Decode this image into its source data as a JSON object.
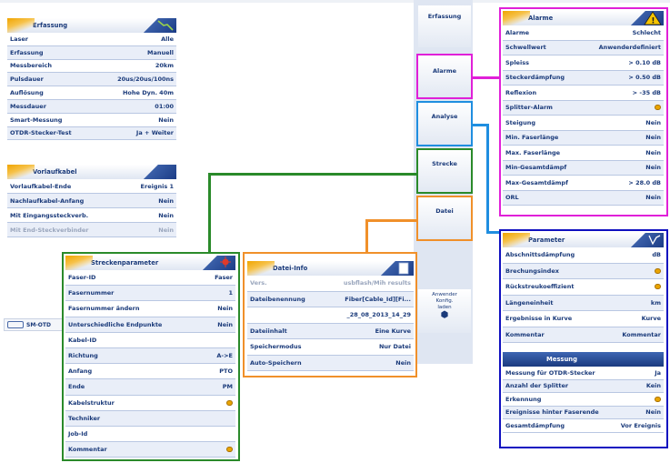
{
  "erfassung_panel": {
    "title": "Erfassung",
    "rows": [
      {
        "label": "Laser",
        "value": "Alle"
      },
      {
        "label": "Erfassung",
        "value": "Manuell"
      },
      {
        "label": "Messbereich",
        "value": "20km"
      },
      {
        "label": "Pulsdauer",
        "value": "20us/20us/100ns"
      },
      {
        "label": "Auflösung",
        "value": "Hohe Dyn. 40m"
      },
      {
        "label": "Messdauer",
        "value": "01:00"
      },
      {
        "label": "Smart-Messung",
        "value": "Nein"
      },
      {
        "label": "OTDR-Stecker-Test",
        "value": "Ja + Weiter"
      }
    ]
  },
  "vorlaufkabel_panel": {
    "title": "Vorlaufkabel",
    "rows": [
      {
        "label": "Vorlaufkabel-Ende",
        "value": "Ereignis 1"
      },
      {
        "label": "Nachlaufkabel-Anfang",
        "value": "Nein"
      },
      {
        "label": "Mit Eingangssteckverb.",
        "value": "Nein"
      },
      {
        "label": "Mit End-Steckverbinder",
        "value": "Nein"
      }
    ]
  },
  "status_bar": {
    "label": "SM-OTD"
  },
  "right_menu": {
    "erfassung": "Erfassung",
    "alarme": "Alarme",
    "analyse": "Analyse",
    "strecke": "Strecke",
    "datei": "Datei",
    "bottom": [
      "Anwender",
      "Konfig.",
      "laden"
    ]
  },
  "alarme_panel": {
    "title": "Alarme",
    "rows": [
      {
        "label": "Alarme",
        "value": "Schlecht"
      },
      {
        "label": "Schwellwert",
        "value": "Anwenderdefiniert"
      },
      {
        "label": "Spleiss",
        "value": "> 0.10 dB"
      },
      {
        "label": "Steckerdämpfung",
        "value": "> 0.50 dB"
      },
      {
        "label": "Reflexion",
        "value": "> -35 dB"
      },
      {
        "label": "Splitter-Alarm",
        "value": ""
      },
      {
        "label": "Steigung",
        "value": "Nein"
      },
      {
        "label": "Min. Faserlänge",
        "value": "Nein"
      },
      {
        "label": "Max. Faserlänge",
        "value": "Nein"
      },
      {
        "label": "Min-Gesamtdämpf",
        "value": "Nein"
      },
      {
        "label": "Max-Gesamtdämpf",
        "value": "> 28.0 dB"
      },
      {
        "label": "ORL",
        "value": "Nein"
      }
    ]
  },
  "parameter_panel": {
    "title": "Parameter",
    "rows": [
      {
        "label": "Abschnittsdämpfung",
        "value": "dB"
      },
      {
        "label": "Brechungsindex",
        "value": ""
      },
      {
        "label": "Rückstreukoeffizient",
        "value": ""
      },
      {
        "label": "Längeneinheit",
        "value": "km"
      },
      {
        "label": "Ergebnisse in Kurve",
        "value": "Kurve"
      },
      {
        "label": "Kommentar",
        "value": "Kommentar"
      }
    ]
  },
  "messung_panel": {
    "title": "Messung",
    "rows": [
      {
        "label": "Messung für OTDR-Stecker",
        "value": "Ja"
      },
      {
        "label": "Anzahl der Splitter",
        "value": "Kein"
      },
      {
        "label": "Erkennung",
        "value": ""
      },
      {
        "label": "Ereignisse hinter Faserende",
        "value": "Nein"
      },
      {
        "label": "Gesamtdämpfung",
        "value": "Vor Ereignis"
      }
    ]
  },
  "streckenparameter_panel": {
    "title": "Streckenparameter",
    "rows": [
      {
        "label": "Faser-ID",
        "value": "Faser"
      },
      {
        "label": "Fasernummer",
        "value": "1"
      },
      {
        "label": "Fasernummer ändern",
        "value": "Nein"
      },
      {
        "label": "Unterschiedliche Endpunkte",
        "value": "Nein"
      },
      {
        "label": "Kabel-ID",
        "value": ""
      },
      {
        "label": "Richtung",
        "value": "A->E"
      },
      {
        "label": "Anfang",
        "value": "PTO"
      },
      {
        "label": "Ende",
        "value": "PM"
      },
      {
        "label": "Kabelstruktur",
        "value": ""
      },
      {
        "label": "Techniker",
        "value": ""
      },
      {
        "label": "Job-Id",
        "value": ""
      },
      {
        "label": "Kommentar",
        "value": ""
      }
    ]
  },
  "dateiinfo_panel": {
    "title": "Datei-Info",
    "rows": [
      {
        "label": "Vers.",
        "value": "usbflash/Mih results"
      },
      {
        "label": "Dateibenennung",
        "value": "Fiber[Cable_Id][Fi..."
      },
      {
        "label": "",
        "value": "_28_08_2013_14_29"
      },
      {
        "label": "Dateiinhalt",
        "value": "Eine Kurve"
      },
      {
        "label": "Speichermodus",
        "value": "Nur Datei"
      },
      {
        "label": "Auto-Speichern",
        "value": "Nein"
      }
    ]
  },
  "colors": {
    "magenta": "#e020d8",
    "blue": "#1f8ee0",
    "green": "#2a8a2a",
    "orange": "#f0902a",
    "navy": "#1010c0"
  }
}
